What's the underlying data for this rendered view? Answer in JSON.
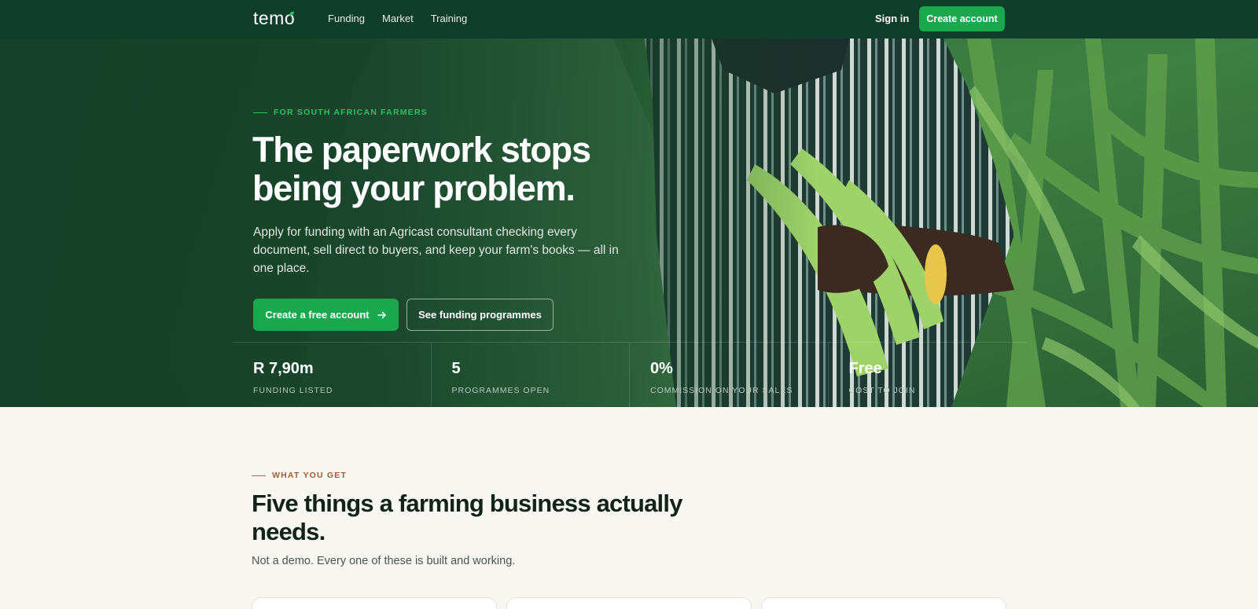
{
  "nav": {
    "logo": "temo",
    "links": [
      "Funding",
      "Market",
      "Training"
    ],
    "signin_label": "Sign in",
    "cta_label": "Create account"
  },
  "hero": {
    "eyebrow": "FOR SOUTH AFRICAN FARMERS",
    "title": "The paperwork stops being your problem.",
    "subtitle": "Apply for funding with an Agricast consultant checking every document, sell direct to buyers, and keep your farm's books — all in one place.",
    "primary_cta": "Create a free account",
    "secondary_cta": "See funding programmes",
    "stats": [
      {
        "value": "R 7,90m",
        "label": "FUNDING LISTED"
      },
      {
        "value": "5",
        "label": "PROGRAMMES OPEN"
      },
      {
        "value": "0%",
        "label": "COMMISSION ON YOUR SALES"
      },
      {
        "value": "Free",
        "label": "COST TO JOIN"
      }
    ]
  },
  "features": {
    "eyebrow": "WHAT YOU GET",
    "title": "Five things a farming business actually needs.",
    "subtitle": "Not a demo. Every one of these is built and working."
  },
  "colors": {
    "nav_bg": "#0e3d2a",
    "accent_green": "#1aa84f",
    "eyebrow_green": "#2fbf62",
    "eyebrow_brown": "#a65a32",
    "page_bg": "#f8f7f2"
  }
}
